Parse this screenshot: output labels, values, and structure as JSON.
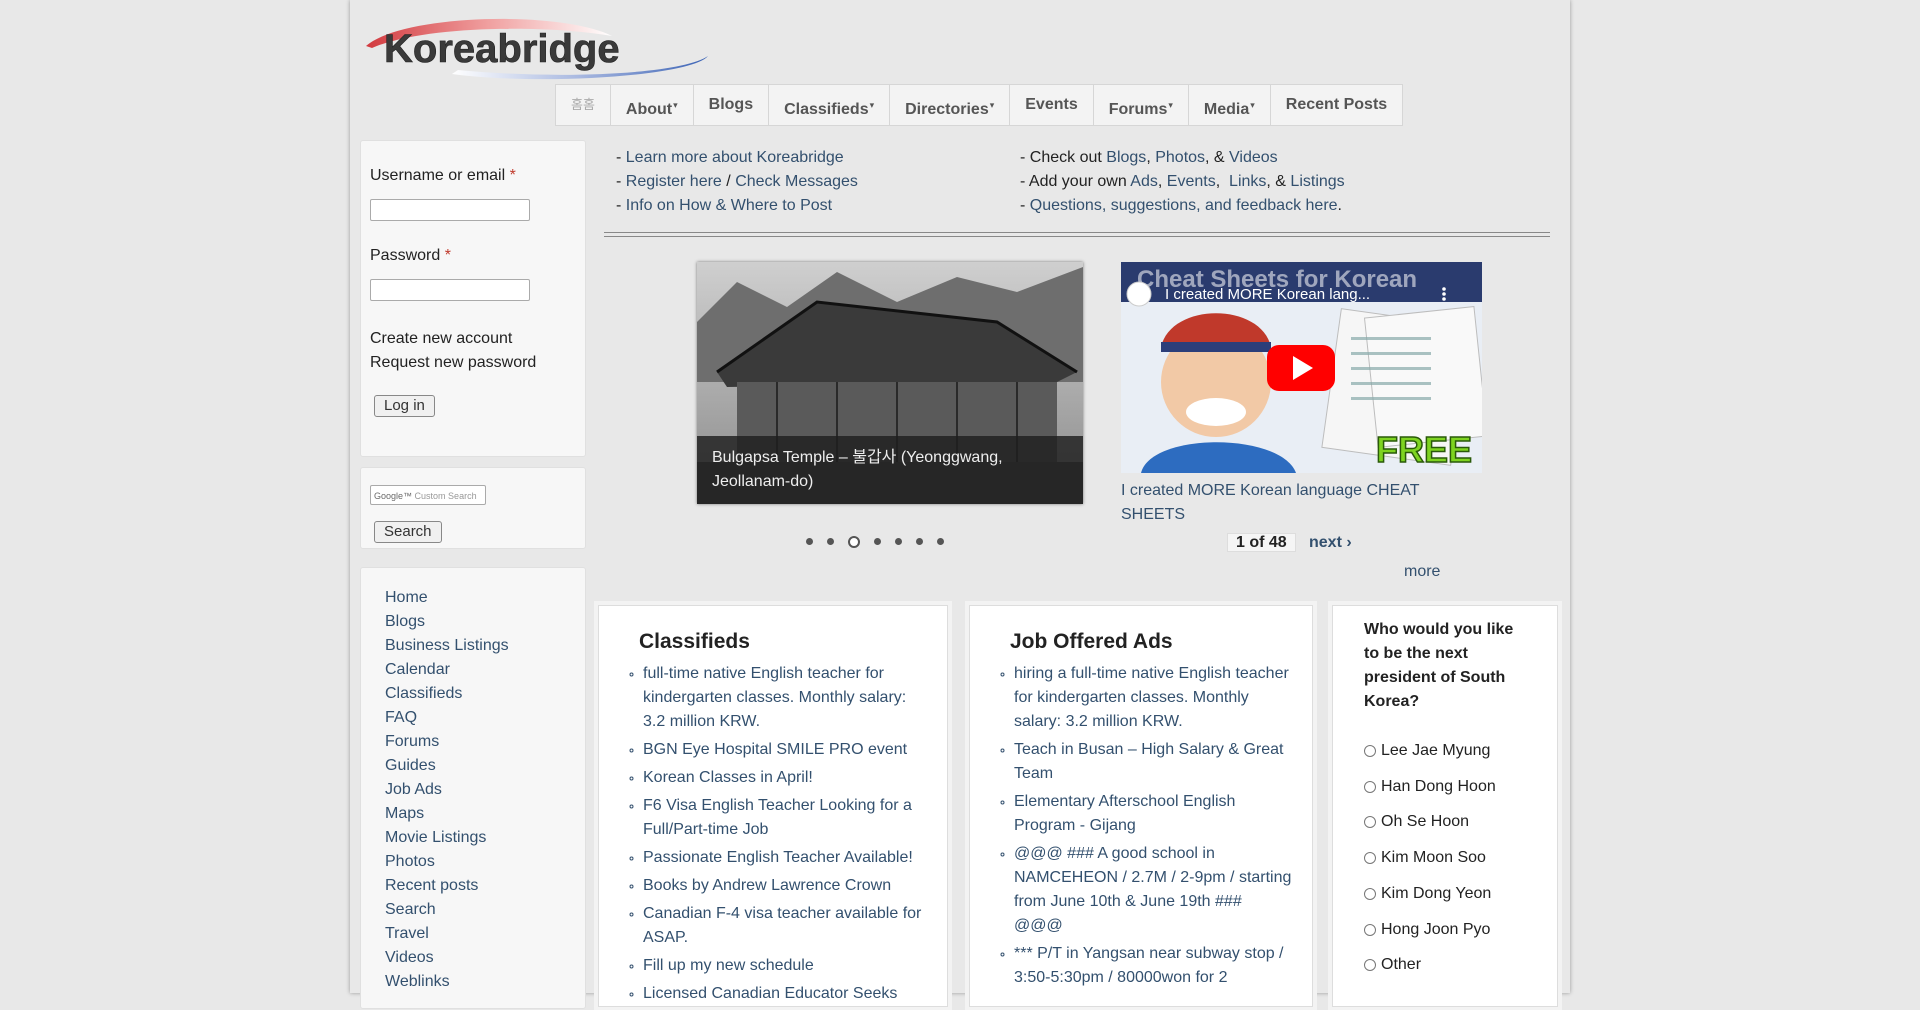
{
  "logo": {
    "text": "Koreabridge"
  },
  "nav": {
    "home_label": "홈홈",
    "items": [
      {
        "label": "About",
        "has_dropdown": true
      },
      {
        "label": "Blogs",
        "has_dropdown": false
      },
      {
        "label": "Classifieds",
        "has_dropdown": true
      },
      {
        "label": "Directories",
        "has_dropdown": true
      },
      {
        "label": "Events",
        "has_dropdown": false
      },
      {
        "label": "Forums",
        "has_dropdown": true
      },
      {
        "label": "Media",
        "has_dropdown": true
      },
      {
        "label": "Recent Posts",
        "has_dropdown": false
      }
    ]
  },
  "login": {
    "username_label": "Username or email",
    "password_label": "Password",
    "required_mark": "*",
    "username_value": "",
    "password_value": "",
    "create_account": "Create new account",
    "request_password": "Request new password",
    "login_button": "Log in"
  },
  "search": {
    "google_label": "Google™",
    "placeholder": "Custom Search",
    "button": "Search"
  },
  "sidebar_menu": [
    "Home",
    "Blogs",
    "Business Listings",
    "Calendar",
    "Classifieds",
    "FAQ",
    "Forums",
    "Guides",
    "Job Ads",
    "Maps",
    "Movie Listings",
    "Photos",
    "Recent posts",
    "Search",
    "Travel",
    "Videos",
    "Weblinks"
  ],
  "intro": {
    "dash": "-",
    "learn_more": "Learn more about Koreabridge",
    "register": "Register here",
    "slash": "/",
    "check_messages": "Check Messages",
    "info_where": "Info on How & Where to Post",
    "check_out": "Check out",
    "blogs": "Blogs",
    "comma": ",",
    "photos": "Photos",
    "amp": ", &",
    "videos": "Videos",
    "add_your_own": "Add your own",
    "ads": "Ads",
    "events": "Events",
    "links": "Links",
    "amp2": ", &",
    "listings": "Listings",
    "questions": "Questions, suggestions, and feedback here",
    "period": "."
  },
  "slideshow": {
    "caption": "Bulgapsa Temple – 불갑사 (Yeonggwang, Jeollanam-do)",
    "total_dots": 7,
    "active_dot": 3
  },
  "video": {
    "overlay_title": "I created MORE Korean lang...",
    "background_title": "Cheat Sheets for Korean",
    "badge": "FREE",
    "title": "I created MORE Korean language CHEAT SHEETS",
    "pager_count": "1 of 48",
    "next": "next ›",
    "more": "more"
  },
  "classifieds": {
    "heading": "Classifieds",
    "items": [
      "full-time native English teacher for kindergarten classes. Monthly salary: 3.2 million KRW.",
      "BGN Eye Hospital SMILE PRO event",
      "Korean Classes in April!",
      "F6 Visa English Teacher Looking for a Full/Part-time Job",
      "Passionate English Teacher Available!",
      "Books by Andrew Lawrence Crown",
      "Canadian F-4 visa teacher available for ASAP.",
      "Fill up my new schedule",
      "Licensed Canadian Educator Seeks"
    ]
  },
  "jobs": {
    "heading": "Job Offered Ads",
    "items": [
      "hiring a full-time native English teacher for kindergarten classes. Monthly salary: 3.2 million KRW.",
      "Teach in Busan – High Salary & Great Team",
      "Elementary Afterschool English Program - Gijang",
      "@@@ ### A good school in NAMCEHEON / 2.7M / 2-9pm / starting from June 10th & June 19th ### @@@",
      "*** P/T in Yangsan near subway stop / 3:50-5:30pm / 80000won for 2"
    ]
  },
  "poll": {
    "question": "Who would you like to be the next president of South Korea?",
    "options": [
      "Lee Jae Myung",
      "Han Dong Hoon",
      "Oh Se Hoon",
      "Kim Moon Soo",
      "Kim Dong Yeon",
      "Hong Joon Pyo",
      "Other"
    ]
  },
  "colors": {
    "link": "#33506e",
    "logo_swoosh_red": "#d23a3f",
    "logo_swoosh_blue": "#3b63b5",
    "youtube_red": "#ff0000"
  }
}
